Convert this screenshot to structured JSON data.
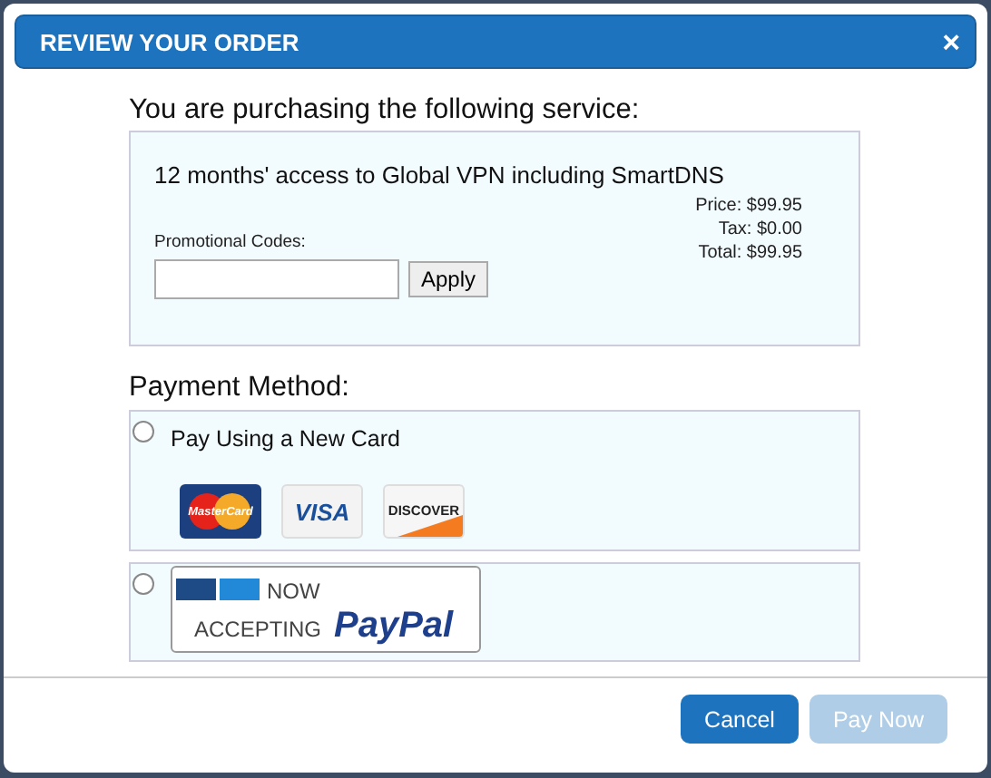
{
  "dialog": {
    "title": "REVIEW YOUR ORDER",
    "close": "×"
  },
  "service": {
    "heading": "You are purchasing the following service:",
    "description": "12 months' access to Global VPN including SmartDNS",
    "promo_label": "Promotional Codes:",
    "apply": "Apply",
    "totals": [
      "Price: $99.95",
      "Tax: $0.00",
      "Total: $99.95"
    ]
  },
  "payment": {
    "heading": "Payment Method:",
    "methods": [
      {
        "kind": "cards",
        "selected": false,
        "label": "Pay Using a New Card",
        "cards": [
          {
            "kind": "mastercard",
            "text": "MasterCard"
          },
          {
            "kind": "visa",
            "text": "VISA"
          },
          {
            "kind": "discover",
            "text": "DISCOVER"
          }
        ]
      },
      {
        "kind": "paypal",
        "selected": false,
        "line1": "NOW",
        "line2": "ACCEPTING",
        "brand": "PayPal"
      }
    ]
  },
  "buttons": [
    {
      "label": "Cancel",
      "disabled": false
    },
    {
      "label": "Pay Now",
      "disabled": true
    }
  ]
}
